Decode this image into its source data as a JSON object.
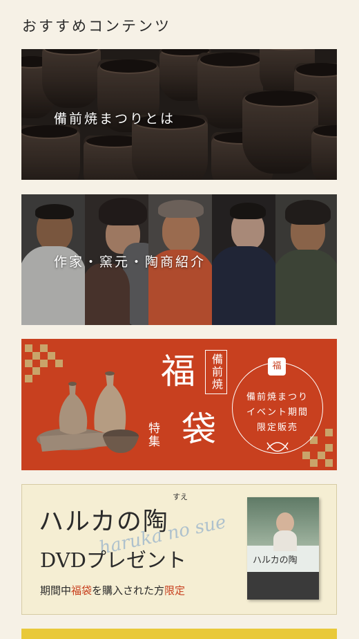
{
  "section": {
    "title": "おすすめコンテンツ"
  },
  "banners": [
    {
      "label": "備前焼まつりとは"
    },
    {
      "label": "作家・窯元・陶商紹介"
    },
    {
      "title_big_1": "福",
      "title_big_2": "袋",
      "vertical_tag": "備前焼",
      "vertical_sub": "特集",
      "bag_mark": "福",
      "circle_lines": [
        "備前焼まつり",
        "イベント期間",
        "限定販売"
      ]
    },
    {
      "title": "ハルカの陶",
      "furigana": "すえ",
      "subtitle": "DVDプレゼント",
      "script_text": "haruka no sue",
      "note_prefix": "期間中",
      "note_hl1": "福袋",
      "note_mid": "を購入された方",
      "note_hl2": "限定",
      "dvd_title": "ハルカの陶"
    }
  ],
  "colors": {
    "accent_red": "#c8401f",
    "gold": "#c9a46a",
    "dvd_bg": "#f5eed3",
    "yellow_banner": "#e9c93a"
  }
}
